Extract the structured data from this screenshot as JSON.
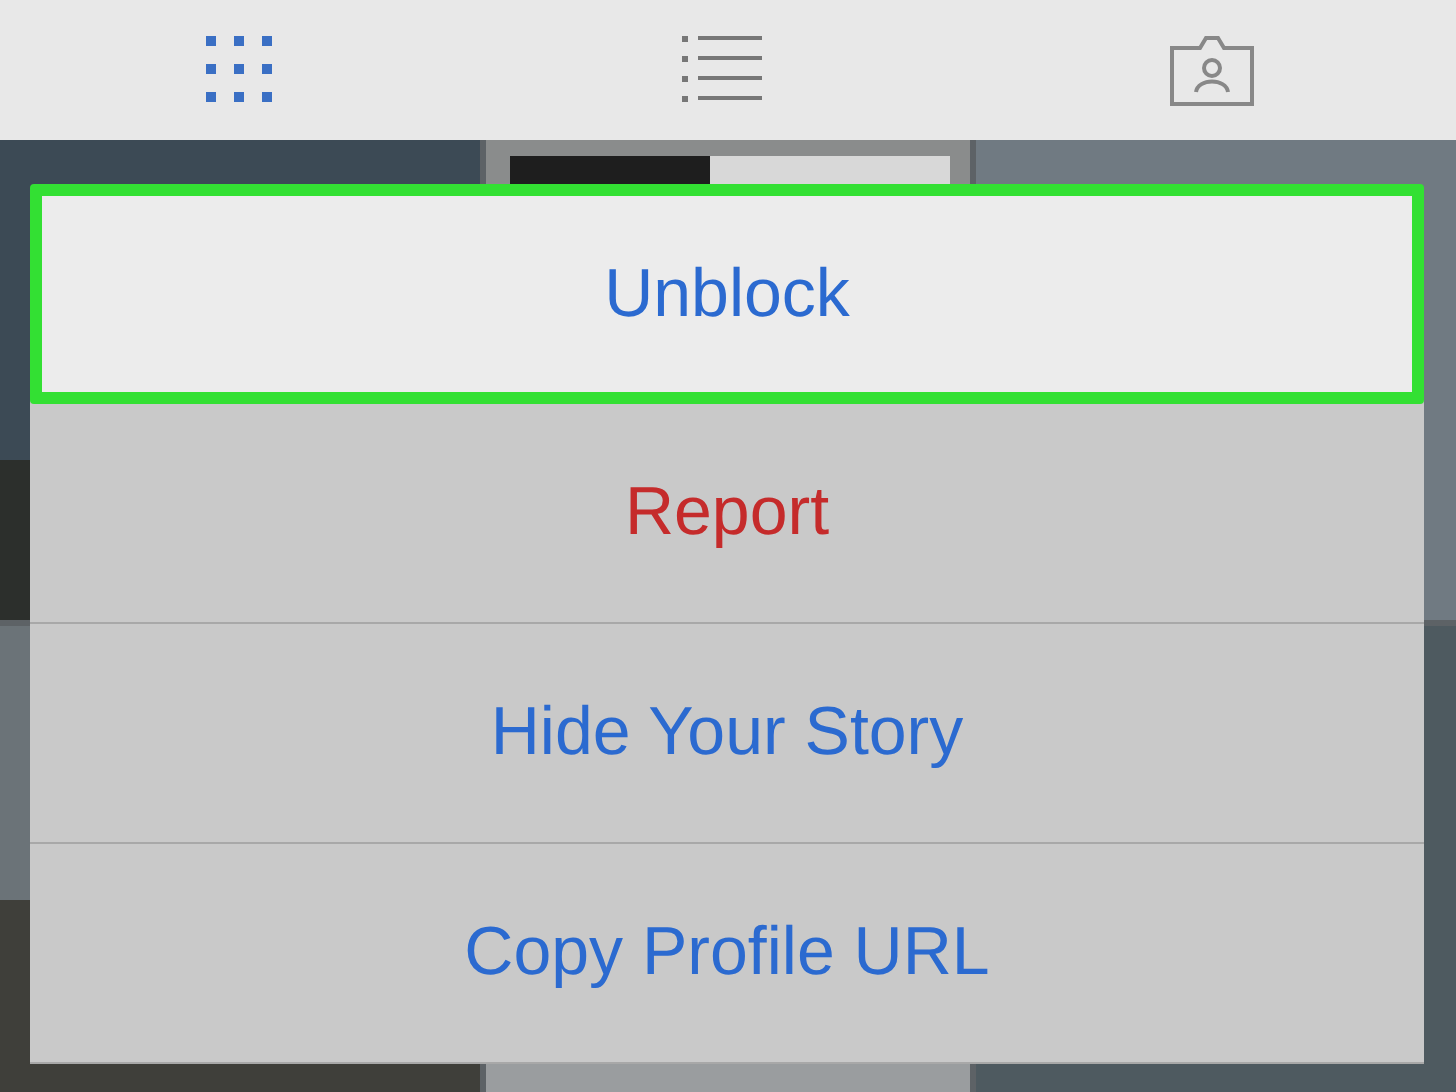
{
  "tab_bar": {
    "tabs": [
      {
        "kind": "grid",
        "selected": true
      },
      {
        "kind": "list",
        "selected": false
      },
      {
        "kind": "tagged",
        "selected": false
      }
    ]
  },
  "action_sheet": {
    "items": [
      {
        "label": "Unblock",
        "kind": "default",
        "highlighted": true
      },
      {
        "label": "Report",
        "kind": "destructive",
        "highlighted": false
      },
      {
        "label": "Hide Your Story",
        "kind": "default",
        "highlighted": false
      },
      {
        "label": "Copy Profile URL",
        "kind": "default",
        "highlighted": false
      }
    ]
  }
}
